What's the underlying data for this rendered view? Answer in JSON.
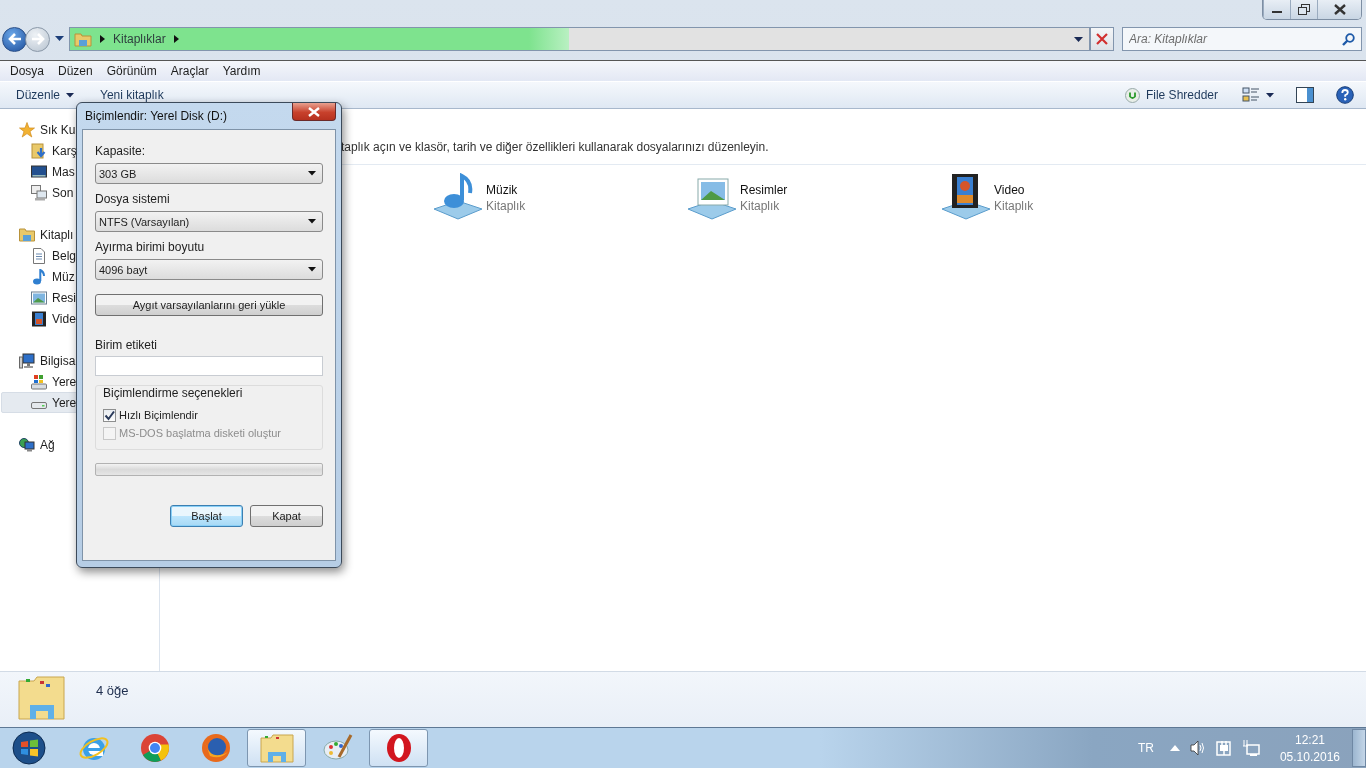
{
  "window": {
    "address_bar": {
      "crumbs": [
        "Kitaplıklar"
      ],
      "level": 0.49
    },
    "search": {
      "placeholder": "Ara: Kitaplıklar"
    }
  },
  "menu": [
    "Dosya",
    "Düzen",
    "Görünüm",
    "Araçlar",
    "Yardım"
  ],
  "toolbar": {
    "organize": "Düzenle",
    "new_library": "Yeni kitaplık",
    "shredder": "File Shredder"
  },
  "sidebar": [
    {
      "label": "Sık Ku",
      "selected": false,
      "children": [
        {
          "label": "Karş",
          "selected": false
        },
        {
          "label": "Mas",
          "selected": false
        },
        {
          "label": "Son",
          "selected": false
        }
      ]
    },
    {
      "label": "Kitaplı",
      "selected": false,
      "children": [
        {
          "label": "Belg",
          "selected": false
        },
        {
          "label": "Müz",
          "selected": false
        },
        {
          "label": "Resi",
          "selected": false
        },
        {
          "label": "Vide",
          "selected": false
        }
      ]
    },
    {
      "label": "Bilgisa",
      "selected": false,
      "children": [
        {
          "label": "Yere",
          "selected": false
        },
        {
          "label": "Yere",
          "selected": true
        }
      ]
    },
    {
      "label": "Ağ",
      "selected": false
    }
  ],
  "content": {
    "description": "taplık açın ve klasör, tarih ve diğer özellikleri kullanarak dosyalarınızı düzenleyin.",
    "libraries": [
      {
        "name": "Müzik",
        "type": "Kitaplık"
      },
      {
        "name": "Resimler",
        "type": "Kitaplık"
      },
      {
        "name": "Video",
        "type": "Kitaplık"
      }
    ]
  },
  "details": {
    "count": "4 öğe"
  },
  "dialog": {
    "title": "Biçimlendir: Yerel Disk (D:)",
    "fields": [
      {
        "label": "Kapasite:",
        "value": "303 GB"
      },
      {
        "label": "Dosya sistemi",
        "value": "NTFS (Varsayılan)"
      },
      {
        "label": "Ayırma birimi boyutu",
        "value": "4096 bayt"
      }
    ],
    "restore_button": "Aygıt varsayılanlarını geri yükle",
    "volume_label": {
      "label": "Birim etiketi"
    },
    "options_title": "Biçimlendirme seçenekleri",
    "options": [
      {
        "label": "Hızlı Biçimlendir",
        "checked": true,
        "disabled": false
      },
      {
        "label": "MS-DOS başlatma disketi oluştur",
        "checked": false,
        "disabled": true
      }
    ],
    "progress": {
      "level": 0
    },
    "buttons": [
      {
        "label": "Başlat",
        "default": true
      },
      {
        "label": "Kapat",
        "default": false
      }
    ]
  },
  "taskbar": {
    "apps": [
      {
        "highlighted": false
      },
      {
        "highlighted": false
      },
      {
        "highlighted": false
      },
      {
        "highlighted": true
      },
      {
        "highlighted": false
      },
      {
        "highlighted": true
      }
    ],
    "language": "TR",
    "time": "12:21",
    "date": "05.10.2016"
  }
}
